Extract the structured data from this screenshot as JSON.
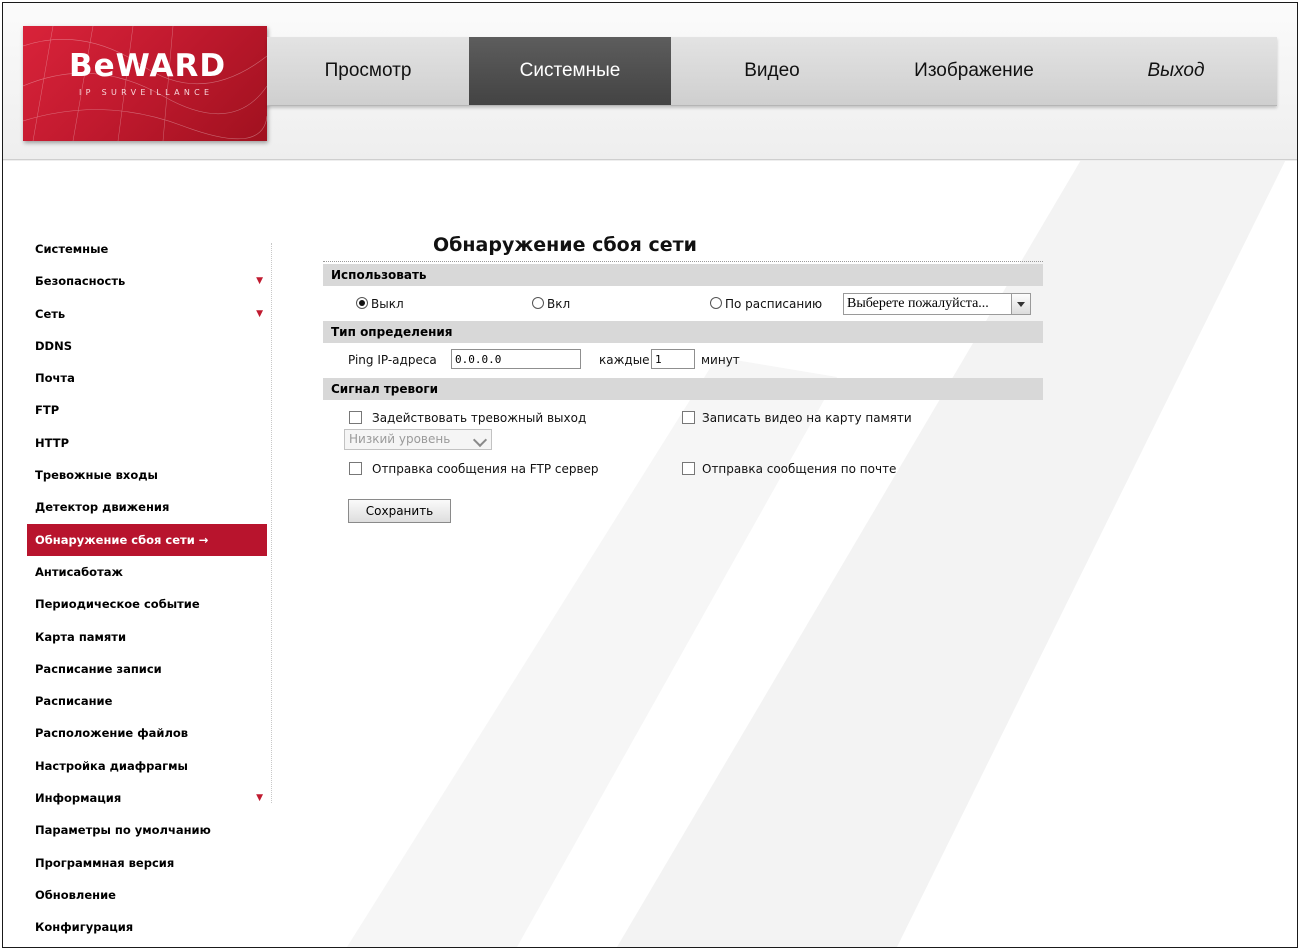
{
  "logo": {
    "text": "BeWARD",
    "sub": "IP SURVEILLANCE"
  },
  "nav": {
    "items": [
      {
        "label": "Просмотр",
        "active": false
      },
      {
        "label": "Системные",
        "active": true
      },
      {
        "label": "Видео",
        "active": false
      },
      {
        "label": "Изображение",
        "active": false
      },
      {
        "label": "Выход",
        "active": false
      }
    ]
  },
  "sidebar": {
    "items": [
      {
        "label": "Системные"
      },
      {
        "label": "Безопасность",
        "arrow": true
      },
      {
        "label": "Сеть",
        "arrow": true
      },
      {
        "label": "DDNS"
      },
      {
        "label": "Почта"
      },
      {
        "label": "FTP"
      },
      {
        "label": "HTTP"
      },
      {
        "label": "Тревожные входы"
      },
      {
        "label": "Детектор движения"
      },
      {
        "label": "Обнаружение сбоя сети →",
        "active": true
      },
      {
        "label": "Антисаботаж"
      },
      {
        "label": "Периодическое событие"
      },
      {
        "label": "Карта памяти"
      },
      {
        "label": "Расписание записи"
      },
      {
        "label": "Расписание"
      },
      {
        "label": "Расположение файлов"
      },
      {
        "label": "Настройка диафрагмы"
      },
      {
        "label": "Информация",
        "arrow": true
      },
      {
        "label": "Параметры по умолчанию"
      },
      {
        "label": "Программная версия"
      },
      {
        "label": "Обновление"
      },
      {
        "label": "Конфигурация"
      }
    ]
  },
  "main": {
    "title": "Обнаружение сбоя сети",
    "use": {
      "header": "Использовать",
      "off_label": "Выкл",
      "on_label": "Вкл",
      "schedule_label": "По расписанию",
      "schedule_select": "Выберете пожалуйста...",
      "selected": "off"
    },
    "detect": {
      "header": "Тип определения",
      "ping_label": "Ping IP-адреса",
      "ip_value": "0.0.0.0",
      "every_label": "каждые",
      "every_value": "1",
      "minutes_label": "минут"
    },
    "alarm": {
      "header": "Сигнал тревоги",
      "alarm_out_label": "Задействовать тревожный выход",
      "record_sd_label": "Записать видео на карту памяти",
      "level_select": "Низкий уровень",
      "ftp_label": "Отправка сообщения на FTP сервер",
      "mail_label": "Отправка сообщения по почте"
    },
    "save_label": "Сохранить"
  }
}
